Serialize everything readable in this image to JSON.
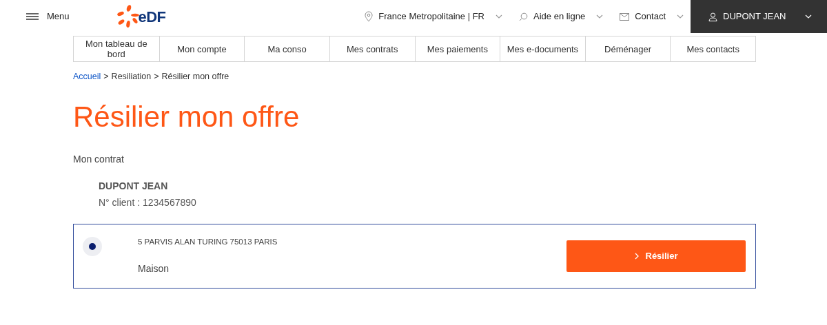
{
  "header": {
    "menu_label": "Menu",
    "logo_text": "eDF",
    "region": "France Metropolitaine | FR",
    "help": "Aide en ligne",
    "contact": "Contact",
    "user": "DUPONT JEAN"
  },
  "nav": [
    {
      "label": "Mon tableau de bord"
    },
    {
      "label": "Mon compte"
    },
    {
      "label": "Ma conso"
    },
    {
      "label": "Mes contrats"
    },
    {
      "label": "Mes paiements"
    },
    {
      "label": "Mes e-documents"
    },
    {
      "label": "Déménager"
    },
    {
      "label": "Mes contacts"
    }
  ],
  "breadcrumb": [
    {
      "label": "Accueil",
      "kind": "link"
    },
    {
      "label": "Resiliation",
      "kind": "text"
    },
    {
      "label": "Résilier mon offre",
      "kind": "text"
    }
  ],
  "breadcrumb_separator": ">",
  "title": "Résilier mon offre",
  "section_label": "Mon contrat",
  "customer": {
    "name": "DUPONT JEAN",
    "client_number": "N° client : 1234567890"
  },
  "contracts": [
    {
      "address": "5 PARVIS ALAN TURING 75013 PARIS",
      "type": "Maison",
      "selected": true,
      "button": "Résilier"
    }
  ]
}
